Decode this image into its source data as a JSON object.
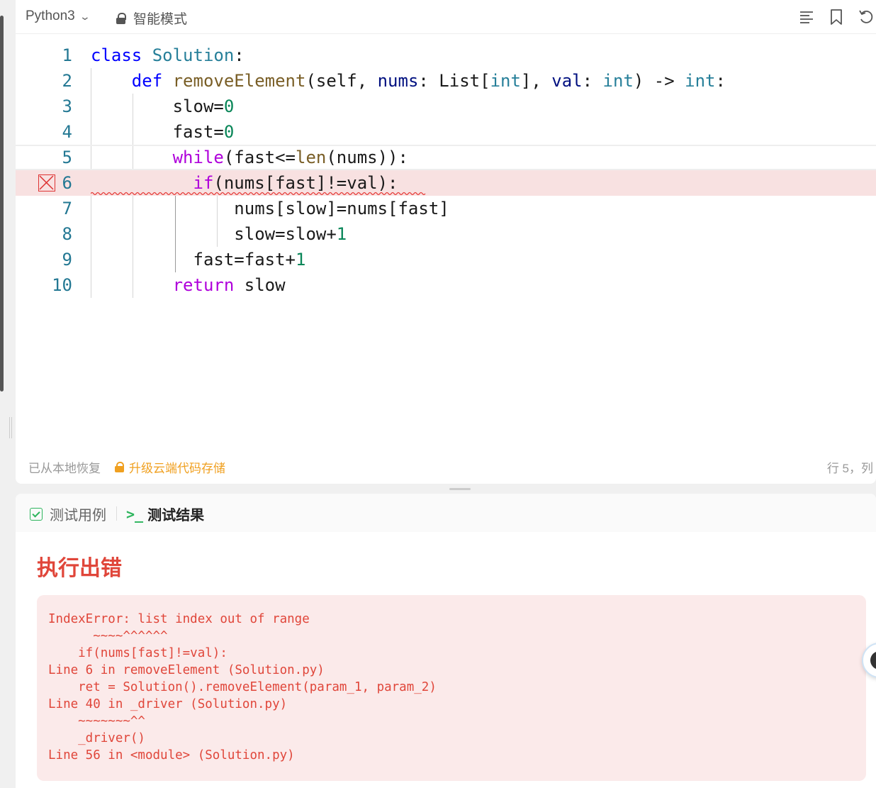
{
  "toolbar": {
    "language": "Python3",
    "mode": "智能模式"
  },
  "editor": {
    "lines": [
      {
        "num": "1"
      },
      {
        "num": "2"
      },
      {
        "num": "3"
      },
      {
        "num": "4"
      },
      {
        "num": "5"
      },
      {
        "num": "6"
      },
      {
        "num": "7"
      },
      {
        "num": "8"
      },
      {
        "num": "9"
      },
      {
        "num": "10"
      }
    ],
    "code": {
      "l1_kw": "class",
      "l1_cls": "Solution",
      "l1_rest": ":",
      "l2_kw": "def",
      "l2_fn": "removeElement",
      "l2_p1": "(self, ",
      "l2_nums": "nums",
      "l2_p2": ": List[",
      "l2_int1": "int",
      "l2_p3": "], ",
      "l2_val": "val",
      "l2_p4": ": ",
      "l2_int2": "int",
      "l2_p5": ") -> ",
      "l2_int3": "int",
      "l2_p6": ":",
      "l3_a": "slow=",
      "l3_n": "0",
      "l4_a": "fast=",
      "l4_n": "0",
      "l5_kw": "while",
      "l5_a": "(fast<=",
      "l5_fn": "len",
      "l5_b": "(nums)):",
      "l6_kw": "if",
      "l6_a": "(nums[fast]!=val):",
      "l7_a": "nums[slow]=nums[fast]",
      "l8_a": "slow=slow+",
      "l8_n": "1",
      "l9_a": "fast=fast+",
      "l9_n": "1",
      "l10_kw": "return",
      "l10_a": " slow"
    }
  },
  "status": {
    "restored": "已从本地恢复",
    "upgrade": "升级云端代码存储",
    "position": "行 5，列"
  },
  "tabs": {
    "testcases": "测试用例",
    "results": "测试结果"
  },
  "result": {
    "title": "执行出错",
    "error_lines": [
      "IndexError: list index out of range",
      "      ~~~~^^^^^^",
      "    if(nums[fast]!=val):",
      "Line 6 in removeElement (Solution.py)",
      "    ret = Solution().removeElement(param_1, param_2)",
      "Line 40 in _driver (Solution.py)",
      "    ~~~~~~~^^",
      "    _driver()",
      "Line 56 in <module> (Solution.py)"
    ]
  },
  "colors": {
    "error": "#e0463a",
    "accent_green": "#2db55d",
    "warning": "#f0a020"
  }
}
